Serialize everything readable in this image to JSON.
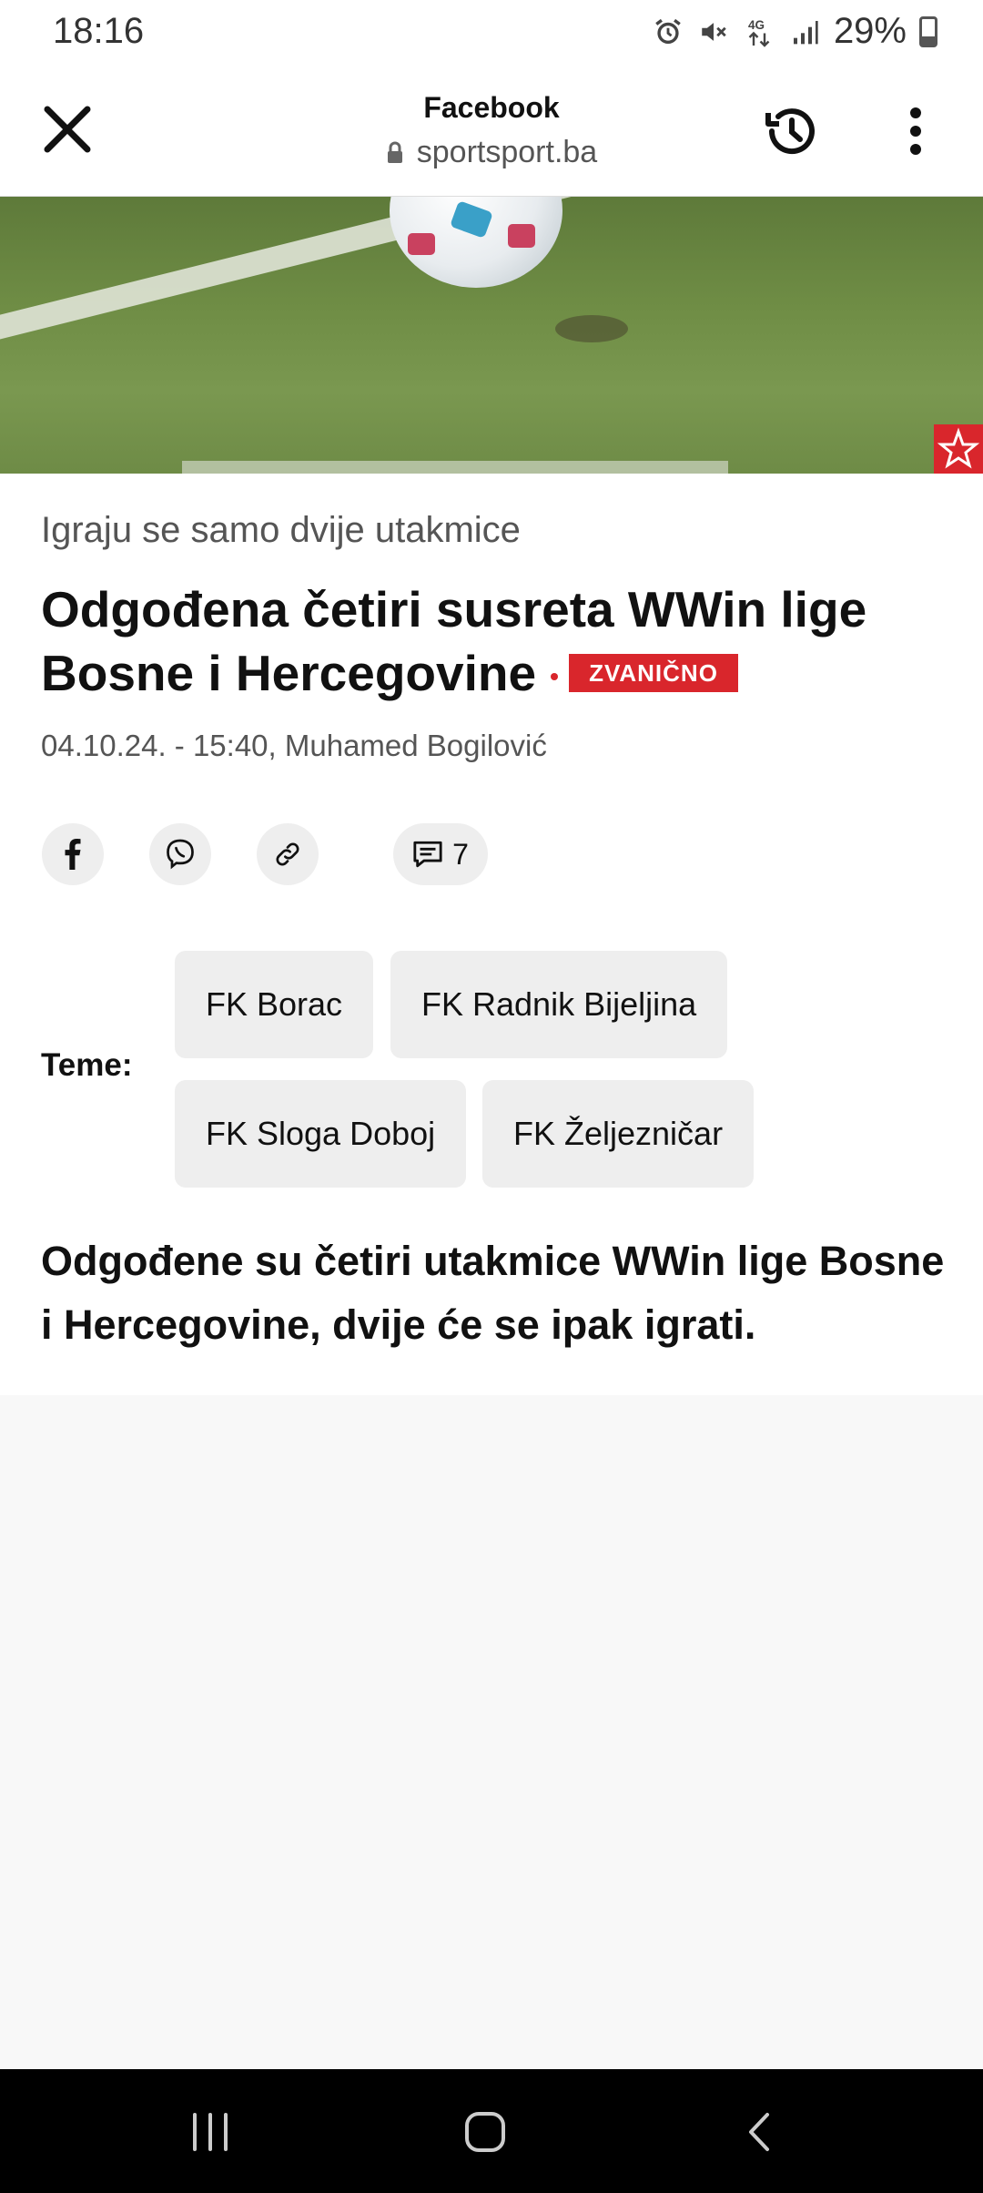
{
  "status_bar": {
    "time": "18:16",
    "battery_text": "29%",
    "icons": [
      "alarm-icon",
      "mute-icon",
      "4g-icon",
      "signal-icon",
      "battery-icon"
    ]
  },
  "toolbar": {
    "title": "Facebook",
    "url": "sportsport.ba",
    "icons": [
      "close-icon",
      "lock-icon",
      "history-icon",
      "more-vert-icon"
    ]
  },
  "hero": {
    "alt_icon": "sportsport-logo-icon",
    "brand_color": "#d9262c"
  },
  "article": {
    "kicker": "Igraju se samo dvije utakmice",
    "headline_line1": "Odgođena četiri susreta WWin lige",
    "headline_line2": "Bosne i Hercegovine",
    "badge": "ZVANIČNO",
    "meta": "04.10.24. - 15:40, Muhamed Bogilović",
    "share_icons": [
      "facebook-icon",
      "viber-icon",
      "link-icon"
    ],
    "comment_count": "7",
    "topics_label": "Teme:",
    "topics": [
      "FK Borac",
      "FK Radnik Bijeljina",
      "FK Sloga Doboj",
      "FK Željezničar"
    ],
    "lead": "Odgođene su četiri utakmice WWin lige Bosne i Hercegovine, dvije će se ipak igrati."
  },
  "navbar": {
    "icons": [
      "recents-icon",
      "home-icon",
      "back-icon"
    ]
  }
}
